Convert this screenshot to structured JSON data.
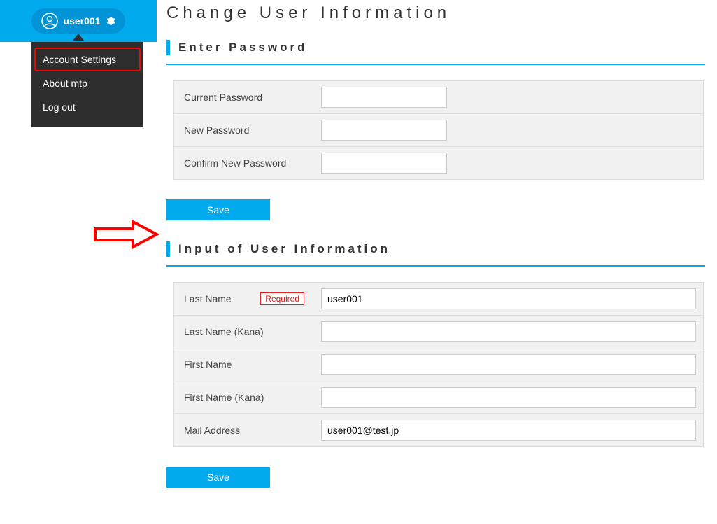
{
  "user": {
    "name": "user001"
  },
  "dropdown": {
    "items": [
      {
        "label": "Account Settings"
      },
      {
        "label": "About mtp"
      },
      {
        "label": "Log out"
      }
    ]
  },
  "page": {
    "title": "Change User Information"
  },
  "sections": {
    "password": {
      "title": "Enter Password",
      "fields": {
        "current": {
          "label": "Current Password",
          "value": ""
        },
        "new": {
          "label": "New Password",
          "value": ""
        },
        "confirm": {
          "label": "Confirm New Password",
          "value": ""
        }
      },
      "save_label": "Save"
    },
    "userinfo": {
      "title": "Input of User Information",
      "required_badge": "Required",
      "fields": {
        "last_name": {
          "label": "Last Name",
          "value": "user001"
        },
        "last_name_kana": {
          "label": "Last Name (Kana)",
          "value": ""
        },
        "first_name": {
          "label": "First Name",
          "value": ""
        },
        "first_name_kana": {
          "label": "First Name (Kana)",
          "value": ""
        },
        "mail": {
          "label": "Mail Address",
          "value": "user001@test.jp"
        }
      },
      "save_label": "Save"
    }
  }
}
